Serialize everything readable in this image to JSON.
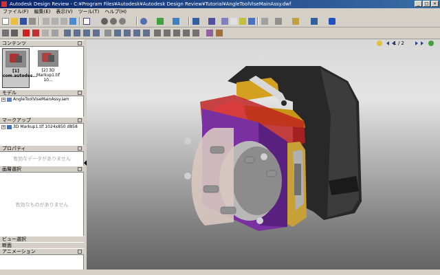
{
  "window": {
    "title": "Autodesk Design Review - C:¥Program Files¥Autodesk¥Autodesk Design Review¥Tutorial¥AngleToolViseMainAssy.dwf",
    "minimize": "_",
    "maximize": "□",
    "close": "×"
  },
  "menu": [
    "ファイル(F)",
    "編集(E)",
    "表示(V)",
    "ツール(T)",
    "ヘルプ(H)"
  ],
  "panels": {
    "contents": {
      "title": "コンテンツ",
      "thumbnails": [
        {
          "label1": "[1]",
          "label2": "com.autodes..."
        },
        {
          "label1": "[2] 3D",
          "label2": "Markup1.tif 10..."
        }
      ]
    },
    "model": {
      "title": "モデル",
      "items": [
        "AngleToolViseMainAssy.iam"
      ]
    },
    "markup": {
      "title": "マークアップ",
      "items": [
        "3D Markup1.tif 1024x850 d858"
      ]
    },
    "properties": {
      "title": "プロパティ",
      "empty": "有効なデータがありません"
    },
    "selection": {
      "title": "画層選択",
      "empty": "有効なものがありません"
    },
    "view_selection": {
      "title": "ビュー選択"
    },
    "section": {
      "title": "断面"
    },
    "animation": {
      "title": "アニメーション"
    }
  },
  "viewport": {
    "page_current": "1",
    "page_separator": "/",
    "page_total": "2"
  },
  "colors": {
    "titlebar_start": "#0a246a",
    "titlebar_end": "#3a6ea5",
    "chrome": "#d4d0c8",
    "model_red": "#c02020",
    "model_purple": "#7a30a0",
    "model_gold": "#d4a020",
    "model_black": "#282828"
  }
}
